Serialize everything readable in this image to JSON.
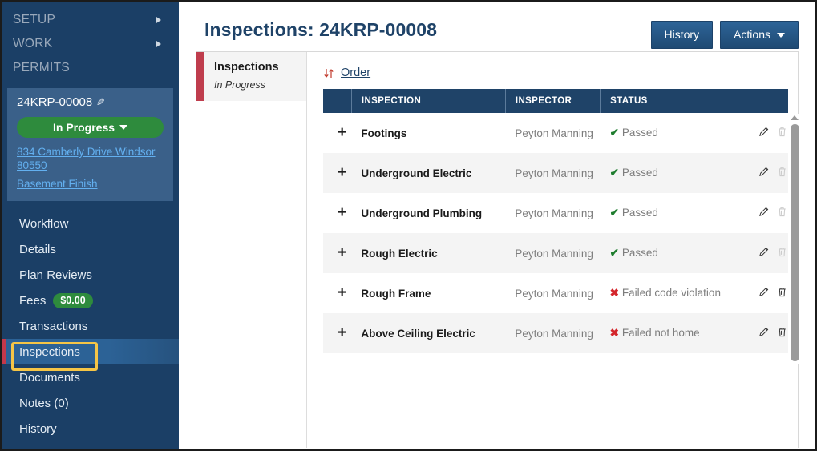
{
  "sidebar": {
    "groups": [
      {
        "label": "SETUP",
        "has_caret": true,
        "icon": "chevron-right-icon"
      },
      {
        "label": "WORK",
        "has_caret": true,
        "icon": "chevron-right-icon"
      },
      {
        "label": "PERMITS",
        "has_caret": false,
        "icon": ""
      }
    ],
    "permit_card": {
      "permit_number": "24KRP-00008",
      "edit_icon": "pencil-icon",
      "status_label": "In Progress",
      "status_color": "#2e8b3d",
      "address_line": "834 Camberly Drive Windsor 80550",
      "project_link": "Basement Finish"
    },
    "nav_items": [
      {
        "label": "Workflow",
        "active": false
      },
      {
        "label": "Details",
        "active": false
      },
      {
        "label": "Plan Reviews",
        "active": false
      },
      {
        "label": "Fees",
        "active": false,
        "badge": "$0.00"
      },
      {
        "label": "Transactions",
        "active": false
      },
      {
        "label": "Inspections",
        "active": true
      },
      {
        "label": "Documents",
        "active": false
      },
      {
        "label": "Notes  (0)",
        "active": false
      },
      {
        "label": "History",
        "active": false
      }
    ],
    "highlight_color": "#f5c546",
    "accent_color": "#c4384a",
    "background_color": "#1b3f66"
  },
  "header": {
    "title": "Inspections: 24KRP-00008",
    "history_button": "History",
    "actions_button": "Actions",
    "actions_caret_icon": "chevron-down-icon",
    "annotation_arrow_icon": "arrow-right-icon",
    "annotation_arrow_color": "#f5c546"
  },
  "tab_panel": {
    "title": "Inspections",
    "subtitle": "In Progress",
    "accent_color": "#bf3d4d"
  },
  "toolbar": {
    "sort_icon": "sort-updown-icon",
    "order_label": "Order"
  },
  "grid": {
    "columns": [
      "",
      "INSPECTION",
      "INSPECTOR",
      "STATUS",
      ""
    ],
    "expand_icon": "plus-icon",
    "edit_icon": "pencil-icon",
    "delete_icon": "trash-icon",
    "rows": [
      {
        "inspection": "Footings",
        "inspector": "Peyton Manning",
        "status": "Passed",
        "status_type": "pass",
        "status_mark": "✔",
        "delete_enabled": false
      },
      {
        "inspection": "Underground Electric",
        "inspector": "Peyton Manning",
        "status": "Passed",
        "status_type": "pass",
        "status_mark": "✔",
        "delete_enabled": false
      },
      {
        "inspection": "Underground Plumbing",
        "inspector": "Peyton Manning",
        "status": "Passed",
        "status_type": "pass",
        "status_mark": "✔",
        "delete_enabled": false
      },
      {
        "inspection": "Rough Electric",
        "inspector": "Peyton Manning",
        "status": "Passed",
        "status_type": "pass",
        "status_mark": "✔",
        "delete_enabled": false
      },
      {
        "inspection": "Rough Frame",
        "inspector": "Peyton Manning",
        "status": "Failed code violation",
        "status_type": "fail",
        "status_mark": "✖",
        "delete_enabled": true
      },
      {
        "inspection": "Above Ceiling Electric",
        "inspector": "Peyton Manning",
        "status": "Failed not home",
        "status_type": "fail",
        "status_mark": "✖",
        "delete_enabled": true
      }
    ],
    "scrollbar": {
      "icon": "scrollbar-vertical",
      "up_arrow_icon": "caret-up-icon"
    }
  },
  "colors": {
    "pass": "#1e7d2e",
    "fail": "#d4262c",
    "header_blue": "#1f4368",
    "link_blue": "#63b0f0"
  }
}
